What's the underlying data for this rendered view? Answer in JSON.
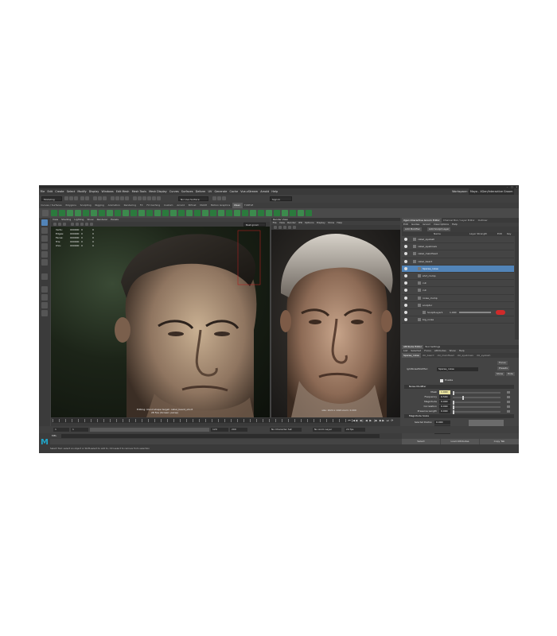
{
  "app": {
    "title": "Autodesk Maya",
    "workspace_label": "Workspace:",
    "workspace_value": "Maya - XGen/Interactive Groom"
  },
  "menubar": [
    "File",
    "Edit",
    "Create",
    "Select",
    "Modify",
    "Display",
    "Windows",
    "Edit Mesh",
    "Mesh Tools",
    "Mesh Display",
    "Curves",
    "Surfaces",
    "Deform",
    "UV",
    "Generate",
    "Cache",
    "Vue-xStream",
    "Arnold",
    "Help"
  ],
  "status_line": {
    "mode": "Modeling",
    "no_live_surface": "No Live Surface",
    "sign_in": "Sign In"
  },
  "shelf_tabs": [
    {
      "label": "Curves / Surfaces",
      "active": false
    },
    {
      "label": "Polygons",
      "active": false
    },
    {
      "label": "Sculpting",
      "active": false
    },
    {
      "label": "Rigging",
      "active": false
    },
    {
      "label": "Animation",
      "active": false
    },
    {
      "label": "Rendering",
      "active": false
    },
    {
      "label": "FX",
      "active": false
    },
    {
      "label": "FX Caching",
      "active": false
    },
    {
      "label": "Custom",
      "active": false
    },
    {
      "label": "Arnold",
      "active": false
    },
    {
      "label": "Bifrost",
      "active": false
    },
    {
      "label": "MASH",
      "active": false
    },
    {
      "label": "Motion Graphics",
      "active": false
    },
    {
      "label": "XGen",
      "active": true
    },
    {
      "label": "TURTLE",
      "active": false
    }
  ],
  "viewport": {
    "menu": [
      "View",
      "Shading",
      "Lighting",
      "Show",
      "Renderer",
      "Panels"
    ],
    "hud": [
      {
        "label": "Verts:",
        "v1": "000000",
        "v2": "0",
        "v3": "0"
      },
      {
        "label": "Edges:",
        "v1": "000000",
        "v2": "0",
        "v3": "0"
      },
      {
        "label": "Faces:",
        "v1": "000000",
        "v2": "0",
        "v3": "0"
      },
      {
        "label": "Tris:",
        "v1": "000000",
        "v2": "0",
        "v3": "0"
      },
      {
        "label": "UVs:",
        "v1": "000000",
        "v2": "0",
        "v3": "0"
      }
    ],
    "caption_line1": "Editing: blend shape target: cabel_beard_short",
    "caption_line2": "28 Fps (Screen: persp)",
    "camera_field": "Mesh groom"
  },
  "render_view": {
    "title": "Render View",
    "menu": [
      "File",
      "View",
      "Render",
      "IPR",
      "Options",
      "Display",
      "Show",
      "Help"
    ],
    "caption": "size: 1024 x 1024 zoom: 0.409"
  },
  "right_panel": {
    "tabs": [
      {
        "label": "Xgen Interactive Groom Editor",
        "active": true
      },
      {
        "label": "Channel Box / Layer Editor",
        "active": false
      },
      {
        "label": "Outliner",
        "active": false
      }
    ],
    "menu": [
      "Edit",
      "Guides",
      "Groom",
      "Descriptions",
      "Help"
    ],
    "add_modifier": "Add Modifier",
    "add_sculpt_layer": "Add Sculpt Layer",
    "layer_headers": {
      "name": "Name",
      "layer_strength": "Layer Strength",
      "edit": "Edit",
      "key": "Key"
    },
    "layers": [
      {
        "name": "cabel_eyelash",
        "indent": 1,
        "selected": false
      },
      {
        "name": "cabel_eyebrows",
        "indent": 1,
        "selected": false
      },
      {
        "name": "cabel_mainHead",
        "indent": 1,
        "selected": false
      },
      {
        "name": "cabel_beard",
        "indent": 1,
        "selected": false
      },
      {
        "name": "Sparse_noise",
        "indent": 2,
        "selected": true
      },
      {
        "name": "shrt_clump",
        "indent": 2,
        "selected": false
      },
      {
        "name": "cut",
        "indent": 2,
        "selected": false
      },
      {
        "name": "cut",
        "indent": 2,
        "selected": false
      },
      {
        "name": "noise_clump",
        "indent": 2,
        "selected": false
      },
      {
        "name": "sculptor",
        "indent": 2,
        "selected": false
      },
      {
        "name": "SculptLayer1",
        "indent": 3,
        "selected": false,
        "strength": "1.000"
      },
      {
        "name": "big_noise",
        "indent": 2,
        "selected": false
      }
    ]
  },
  "attribute_editor": {
    "title_tabs": [
      {
        "label": "Attribute Editor",
        "active": true
      },
      {
        "label": "Tool Settings",
        "active": false
      }
    ],
    "menu": [
      "List",
      "Selected",
      "Focus",
      "Attributes",
      "Show",
      "Help"
    ],
    "node_tabs": [
      {
        "label": "Sparse_noise",
        "active": true
      },
      {
        "label": "cbl_beard",
        "active": false
      },
      {
        "label": "cbl_mainHead",
        "active": false
      },
      {
        "label": "cbl_eyebrows",
        "active": false
      },
      {
        "label": "cbl_eyelash",
        "active": false
      }
    ],
    "type_label": "igmNoiseModifier:",
    "type_value": "Sparse_noise",
    "focus_btn": "Focus",
    "presets_btn": "Presets",
    "show_btn": "Show",
    "hide_btn": "Hide",
    "enable_label": "Enable",
    "section1": "Noise Modifier",
    "params": [
      {
        "label": "Mask",
        "value": "1.000",
        "fill": 0.0
      },
      {
        "label": "Frequency",
        "value": "0.500",
        "fill": 0.2
      },
      {
        "label": "Magnitude",
        "value": "0.000",
        "fill": 0.0
      },
      {
        "label": "Correlation",
        "value": "0.000",
        "fill": 0.0
      },
      {
        "label": "Preserve Length",
        "value": "0.000",
        "fill": 0.0
      }
    ],
    "section2": "Magnitude Scale",
    "ramp_params": [
      {
        "label": "Selected Position",
        "value": "0.000"
      },
      {
        "label": "Selected Value",
        "value": "0.000"
      },
      {
        "label": "Interpolation",
        "value": "Linear"
      }
    ],
    "buttons": [
      "Select",
      "Load Attributes",
      "Copy Tab"
    ]
  },
  "timeline": {
    "start": "1",
    "current": "1",
    "range_start": "1",
    "range_end": "120",
    "end": "120",
    "end2": "200",
    "char_set": "No Character Set",
    "anim_layer": "No Anim Layer",
    "fps": "24 fps",
    "playback_glyphs": "⏮ ◀◀ ◀| ◀ ▶ |▶ ▶▶ ⏭ ⟳"
  },
  "command_line": {
    "label": "MEL"
  },
  "help_line": "Select Tool: select an object or Shift-select to add to, Ctrl-select to remove from selection",
  "colors": {
    "accent": "#5284b8",
    "shelf_green": "#2b7a3d",
    "maya_blue": "#21a5c7",
    "delete_red": "#d02a2a"
  }
}
